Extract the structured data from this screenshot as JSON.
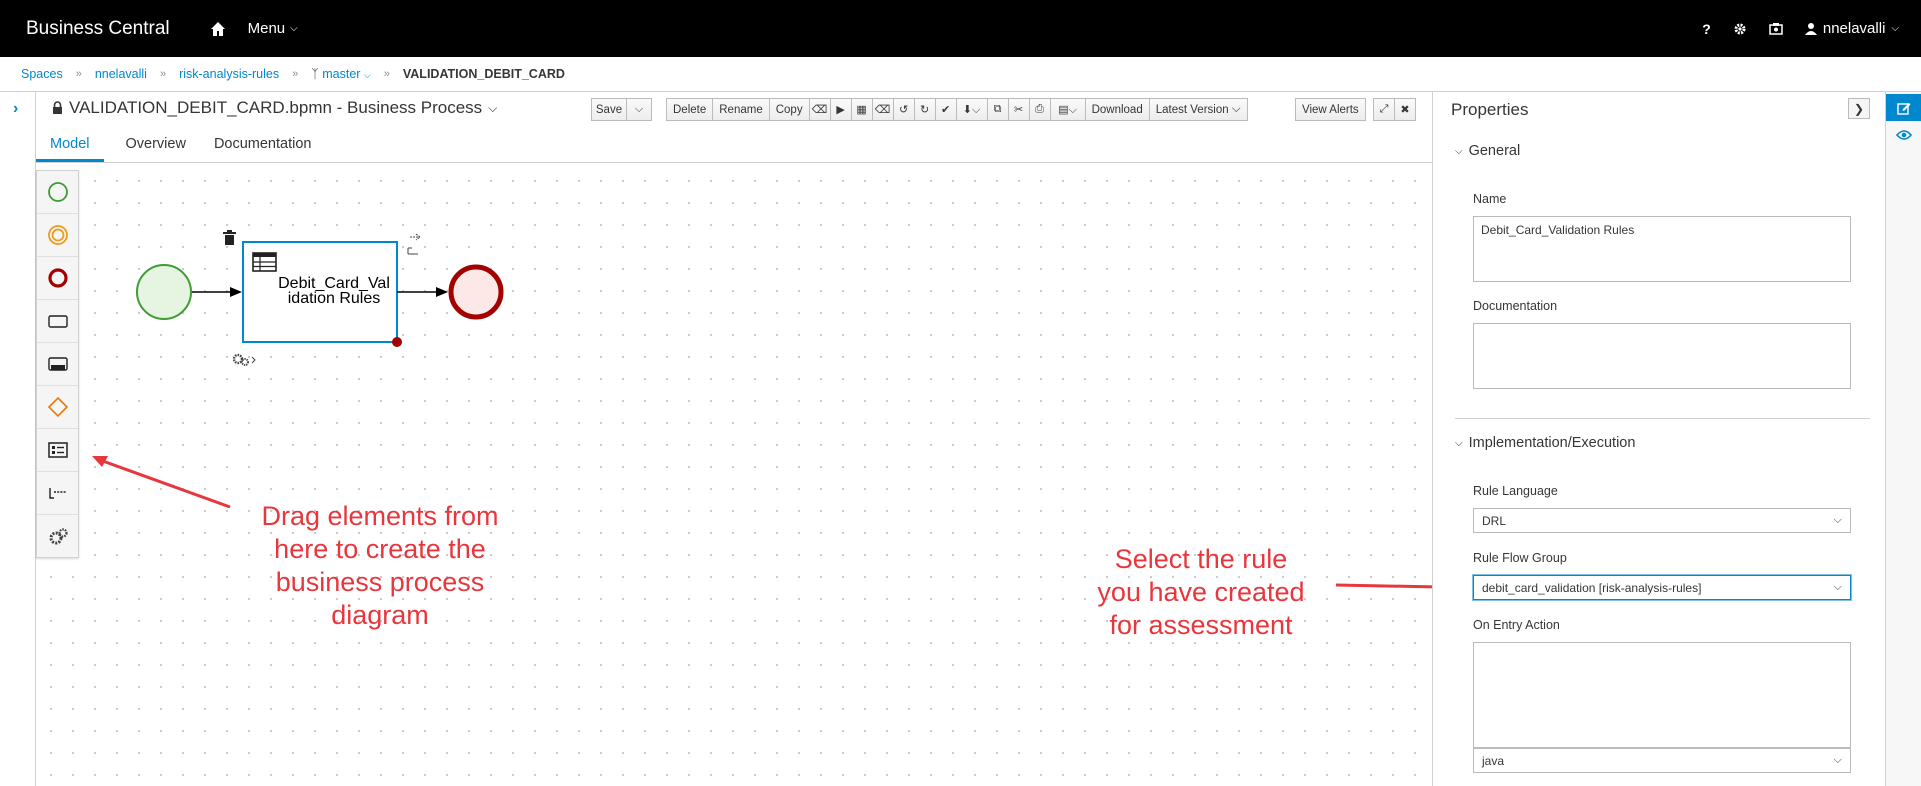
{
  "app": {
    "brand": "Business Central",
    "menu_label": "Menu",
    "help_glyph": "?",
    "user": "nnelavalli"
  },
  "breadcrumb": {
    "items": [
      "Spaces",
      "nnelavalli",
      "risk-analysis-rules",
      "master"
    ],
    "current": "VALIDATION_DEBIT_CARD"
  },
  "editor": {
    "title": "VALIDATION_DEBIT_CARD.bpmn - Business Process",
    "toolbar": {
      "save": "Save",
      "delete": "Delete",
      "rename": "Rename",
      "copy": "Copy",
      "download": "Download",
      "latest_version": "Latest Version",
      "view_alerts": "View Alerts"
    },
    "tabs": [
      "Model",
      "Overview",
      "Documentation"
    ],
    "active_tab": "Model"
  },
  "diagram": {
    "task_label_line1": "Debit_Card_Val",
    "task_label_line2": "idation Rules"
  },
  "palette": {
    "items": [
      "start-event-icon",
      "intermediate-event-icon",
      "end-event-icon",
      "task-icon",
      "subprocess-icon",
      "gateway-icon",
      "container-icon",
      "data-icon",
      "custom-tasks-icon"
    ]
  },
  "properties": {
    "title": "Properties",
    "general_section": "General",
    "name_label": "Name",
    "name_value": "Debit_Card_Validation Rules",
    "documentation_label": "Documentation",
    "documentation_value": "",
    "implementation_section": "Implementation/Execution",
    "rule_language_label": "Rule Language",
    "rule_language_value": "DRL",
    "rule_flow_group_label": "Rule Flow Group",
    "rule_flow_group_value": "debit_card_validation [risk-analysis-rules]",
    "on_entry_label": "On Entry Action",
    "on_entry_value": "",
    "script_language_value": "java"
  },
  "annotations": {
    "left_line1": "Drag elements from",
    "left_line2": "here to create the",
    "left_line3": "business process",
    "left_line4": "diagram",
    "right_line1": "Select the rule",
    "right_line2": "you have created",
    "right_line3": "for assessment"
  },
  "colors": {
    "accent": "#0088ce",
    "annotation": "#e8363d",
    "start_event": "#3f9c35",
    "end_event": "#a30000"
  }
}
